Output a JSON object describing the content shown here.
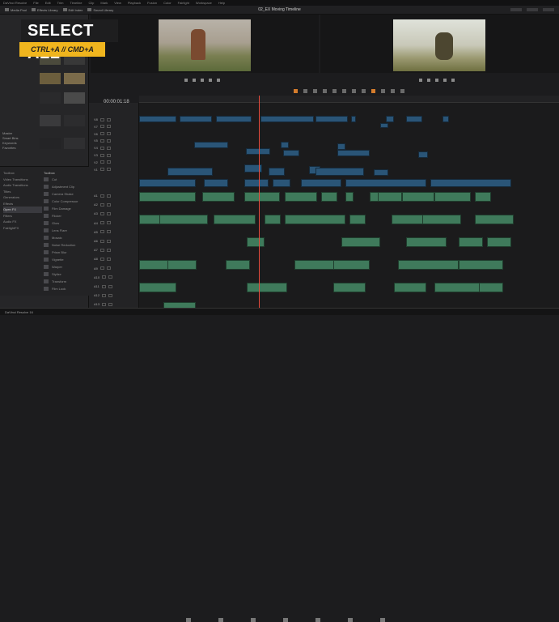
{
  "window": {
    "title": "02_EX Moving Timeline",
    "menu": [
      "DaVinci Resolve",
      "File",
      "Edit",
      "Trim",
      "Timeline",
      "Clip",
      "Mark",
      "View",
      "Playback",
      "Fusion",
      "Color",
      "Fairlight",
      "Workspace",
      "Help"
    ]
  },
  "toolbar": {
    "media_pool": "Media Pool",
    "effects": "Effects Library",
    "edit_index": "Edit Index",
    "sound_library": "Sound Library"
  },
  "overlay": {
    "title": "SELECT ALL",
    "shortcut": "CTRL+A  //  CMD+A"
  },
  "left_panel": {
    "master": "Master",
    "bins": [
      "Smart Bins",
      "Keywords",
      "Favorites"
    ]
  },
  "effects": {
    "header": "Toolbox",
    "tree": [
      "Toolbox",
      "Video Transitions",
      "Audio Transitions",
      "Titles",
      "Generators",
      "Effects",
      "Open FX",
      "Filters",
      "Audio FX",
      "FairlightFX"
    ],
    "selected_index": 6,
    "list": [
      "Cut",
      "Adjustment Clip",
      "Camera Shake",
      "Color Compressor",
      "Film Damage",
      "Flicker",
      "Glow",
      "Lens Flare",
      "Mosaic",
      "Noise Reduction",
      "Prism Blur",
      "Vignette",
      "Warper",
      "Stylize",
      "Transform",
      "Film Look"
    ]
  },
  "timecode": "00:00:01:18",
  "tracks": [
    "V8",
    "V7",
    "V6",
    "V5",
    "V4",
    "V3",
    "V2",
    "V1",
    "A1",
    "A2",
    "A3",
    "A4",
    "A5",
    "A6",
    "A7",
    "A8",
    "A9",
    "A10",
    "A11",
    "A12",
    "A13"
  ],
  "statusbar": {
    "app": "DaVinci Resolve 16"
  }
}
